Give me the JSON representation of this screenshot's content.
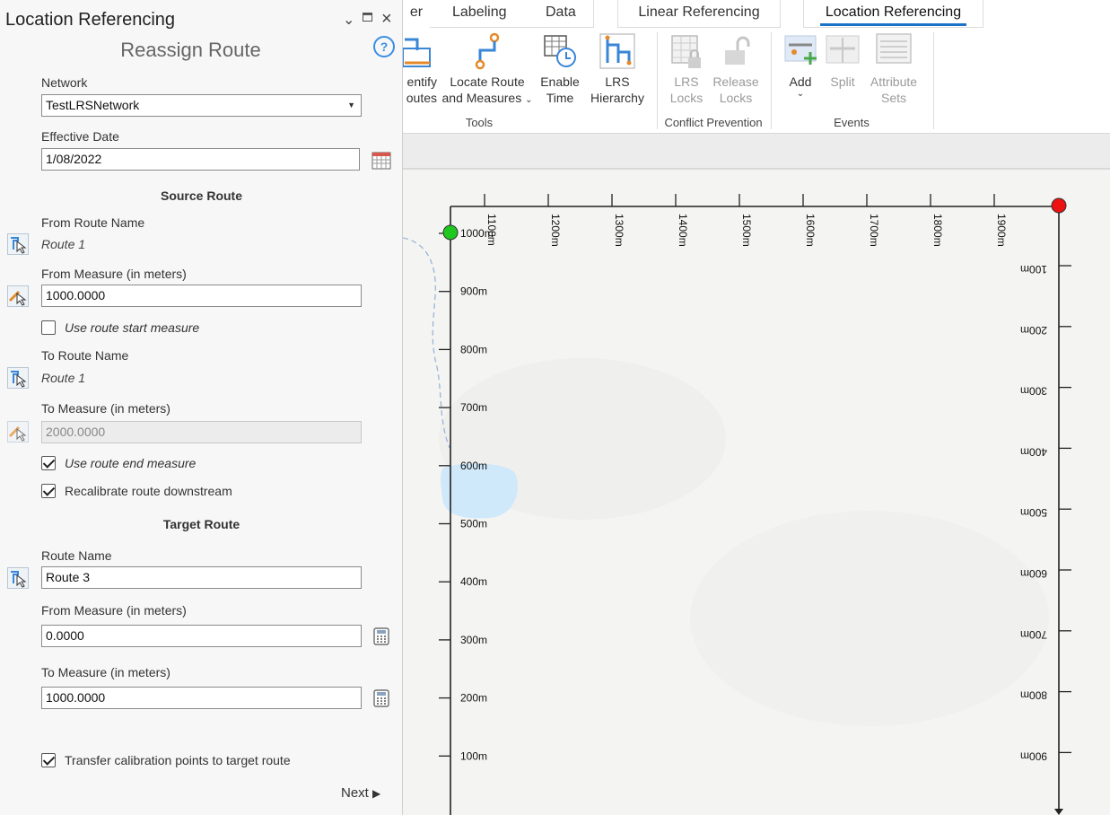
{
  "ribbon": {
    "tabs": [
      {
        "label": "er"
      },
      {
        "label": "Labeling"
      },
      {
        "label": "Data"
      },
      {
        "label": "Linear Referencing"
      },
      {
        "label": "Location Referencing"
      }
    ],
    "buttons": {
      "identify_routes": {
        "line1": "entify",
        "line2": "outes"
      },
      "locate_route": {
        "line1": "Locate Route",
        "line2": "and Measures"
      },
      "enable_time": {
        "line1": "Enable",
        "line2": "Time"
      },
      "lrs_hierarchy": {
        "line1": "LRS",
        "line2": "Hierarchy"
      },
      "lrs_locks": {
        "line1": "LRS",
        "line2": "Locks"
      },
      "release_locks": {
        "line1": "Release",
        "line2": "Locks"
      },
      "add": {
        "line1": "Add"
      },
      "split": {
        "line1": "Split"
      },
      "attribute_sets": {
        "line1": "Attribute",
        "line2": "Sets"
      }
    },
    "groups": {
      "tools": "Tools",
      "conflict": "Conflict Prevention",
      "events": "Events"
    }
  },
  "pane": {
    "title": "Location Referencing",
    "tool_title": "Reassign Route",
    "help": "?",
    "network_label": "Network",
    "network_value": "TestLRSNetwork",
    "effective_date_label": "Effective Date",
    "effective_date_value": "1/08/2022",
    "source_section": "Source Route",
    "from_route_name_label": "From Route Name",
    "from_route_name_value": "Route 1",
    "from_measure_label": "From Measure (in meters)",
    "from_measure_value": "1000.0000",
    "use_start_label": "Use route start measure",
    "use_start_checked": false,
    "to_route_name_label": "To Route Name",
    "to_route_name_value": "Route 1",
    "to_measure_label": "To Measure (in meters)",
    "to_measure_value": "2000.0000",
    "use_end_label": "Use route end measure",
    "use_end_checked": true,
    "recalibrate_label": "Recalibrate route downstream",
    "recalibrate_checked": true,
    "target_section": "Target Route",
    "route_name_label": "Route Name",
    "route_name_value": "Route 3",
    "target_from_label": "From Measure (in meters)",
    "target_from_value": "0.0000",
    "target_to_label": "To Measure (in meters)",
    "target_to_value": "1000.0000",
    "transfer_label": "Transfer calibration points to target route",
    "transfer_checked": true,
    "next_label": "Next"
  },
  "map": {
    "top_axis_labels": [
      "1100m",
      "1200m",
      "1300m",
      "1400m",
      "1500m",
      "1600m",
      "1700m",
      "1800m",
      "1900m"
    ],
    "left_axis_labels": [
      "1000m",
      "900m",
      "800m",
      "700m",
      "600m",
      "500m",
      "400m",
      "300m",
      "200m",
      "100m"
    ],
    "right_axis_labels": [
      "100m",
      "200m",
      "300m",
      "400m",
      "500m",
      "600m",
      "700m",
      "800m",
      "900m"
    ],
    "colors": {
      "start_point": "#1ec81e",
      "end_point": "#ee1111",
      "highlight": "#cfe8fa"
    }
  }
}
